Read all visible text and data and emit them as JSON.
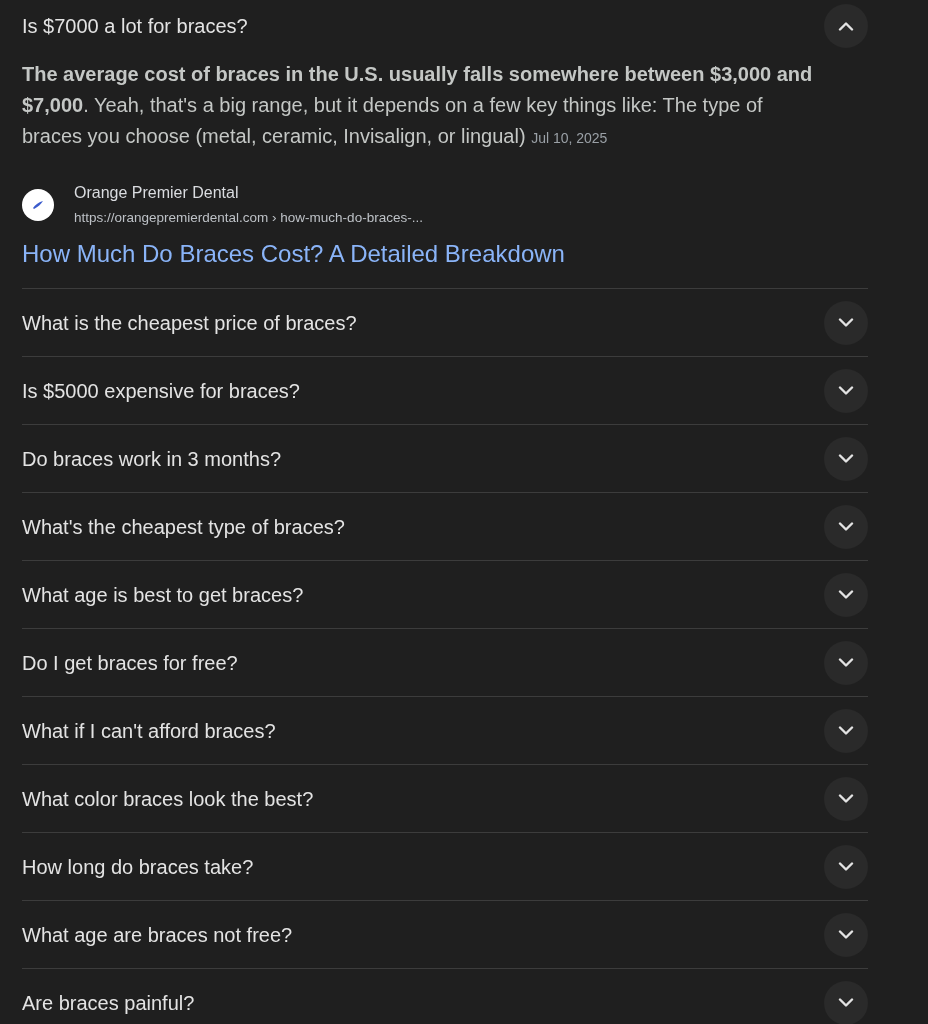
{
  "faq": [
    {
      "question": "Is $7000 a lot for braces?",
      "expanded": true,
      "answer": {
        "text": "**The average cost of braces in the U.S. usually falls somewhere between $3,000 and $7,000**. Yeah, that's a big range, but it depends on a few key things like: The type of braces you choose (metal, ceramic, Invisalign, or lingual)",
        "date": "Jul 10, 2025"
      },
      "source": {
        "name": "Orange Premier Dental",
        "url": "https://orangepremierdental.com › how-much-do-braces-...",
        "title": "How Much Do Braces Cost? A Detailed Breakdown"
      }
    },
    {
      "question": "What is the cheapest price of braces?",
      "expanded": false
    },
    {
      "question": "Is $5000 expensive for braces?",
      "expanded": false
    },
    {
      "question": "Do braces work in 3 months?",
      "expanded": false
    },
    {
      "question": "What's the cheapest type of braces?",
      "expanded": false
    },
    {
      "question": "What age is best to get braces?",
      "expanded": false
    },
    {
      "question": "Do I get braces for free?",
      "expanded": false
    },
    {
      "question": "What if I can't afford braces?",
      "expanded": false
    },
    {
      "question": "What color braces look the best?",
      "expanded": false
    },
    {
      "question": "How long do braces take?",
      "expanded": false
    },
    {
      "question": "What age are braces not free?",
      "expanded": false
    },
    {
      "question": "Are braces painful?",
      "expanded": false
    }
  ]
}
